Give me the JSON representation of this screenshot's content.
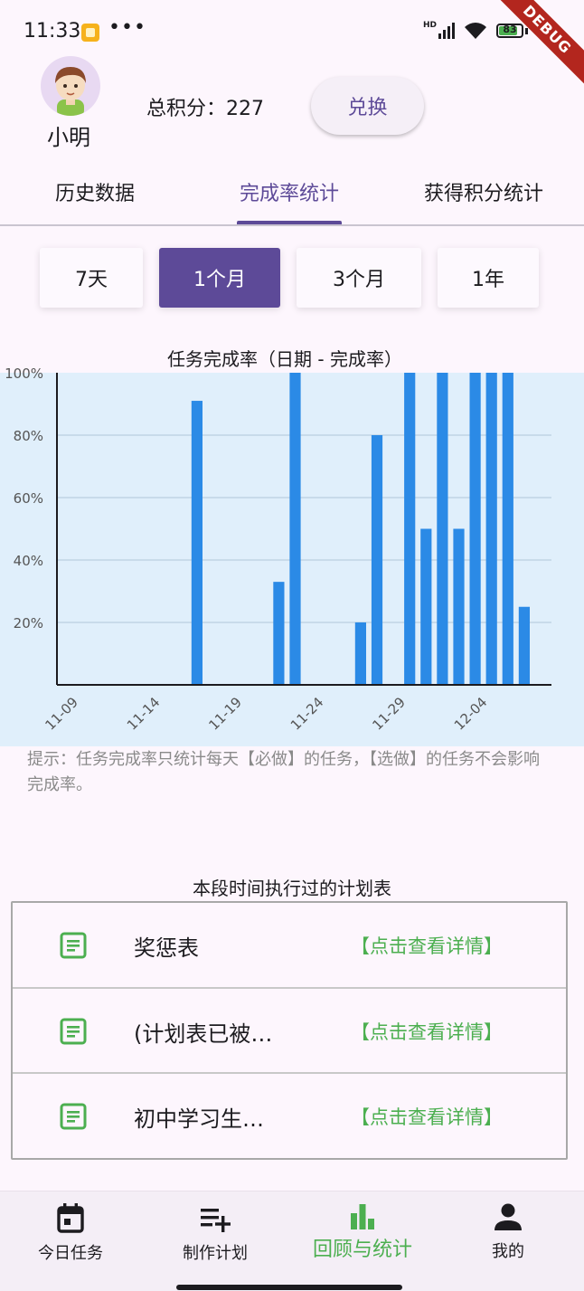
{
  "status_bar": {
    "time": "11:33",
    "more": "•••",
    "hd": "HD",
    "battery": 83
  },
  "debug_banner": "DEBUG",
  "header": {
    "user_name": "小明",
    "points_label": "总积分：",
    "points_value": "227",
    "redeem_label": "兑换"
  },
  "tabs": [
    {
      "label": "历史数据",
      "active": false
    },
    {
      "label": "完成率统计",
      "active": true
    },
    {
      "label": "获得积分统计",
      "active": false
    }
  ],
  "ranges": [
    {
      "label": "7天",
      "active": false
    },
    {
      "label": "1个月",
      "active": true
    },
    {
      "label": "3个月",
      "active": false
    },
    {
      "label": "1年",
      "active": false
    }
  ],
  "chart_data": {
    "type": "bar",
    "title": "任务完成率（日期 - 完成率）",
    "x": [
      "11-09",
      "11-10",
      "11-11",
      "11-12",
      "11-13",
      "11-14",
      "11-15",
      "11-16",
      "11-17",
      "11-18",
      "11-19",
      "11-20",
      "11-21",
      "11-22",
      "11-23",
      "11-24",
      "11-25",
      "11-26",
      "11-27",
      "11-28",
      "11-29",
      "11-30",
      "12-01",
      "12-02",
      "12-03",
      "12-04",
      "12-05",
      "12-06",
      "12-07",
      "12-08"
    ],
    "values": [
      0,
      0,
      0,
      0,
      0,
      0,
      0,
      0,
      91,
      0,
      0,
      0,
      0,
      33,
      100,
      0,
      0,
      0,
      20,
      80,
      0,
      100,
      50,
      100,
      50,
      100,
      100,
      100,
      25,
      0
    ],
    "x_tick_labels": [
      "11-09",
      "11-14",
      "11-19",
      "11-24",
      "11-29",
      "12-04"
    ],
    "y_tick_labels": [
      "20%",
      "40%",
      "60%",
      "80%",
      "100%"
    ],
    "ylim": [
      0,
      100
    ],
    "grid": true,
    "bar_color": "#2b8ae6",
    "plot_background": "#e0effb"
  },
  "hint": "提示：任务完成率只统计每天【必做】的任务，【选做】的任务不会影响完成率。",
  "plans": {
    "title": "本段时间执行过的计划表",
    "rows": [
      {
        "name": "奖惩表",
        "link": "【点击查看详情】"
      },
      {
        "name": "(计划表已被…",
        "link": "【点击查看详情】"
      },
      {
        "name": "初中学习生…",
        "link": "【点击查看详情】"
      }
    ]
  },
  "bottom_nav": [
    {
      "label": "今日任务",
      "icon": "calendar-today-icon",
      "active": false
    },
    {
      "label": "制作计划",
      "icon": "playlist-add-icon",
      "active": false
    },
    {
      "label": "回顾与统计",
      "icon": "bar-chart-icon",
      "active": true
    },
    {
      "label": "我的",
      "icon": "person-icon",
      "active": false
    }
  ],
  "colors": {
    "primary": "#5d4a98",
    "accent_green": "#4caf50",
    "bar": "#2b8ae6"
  }
}
